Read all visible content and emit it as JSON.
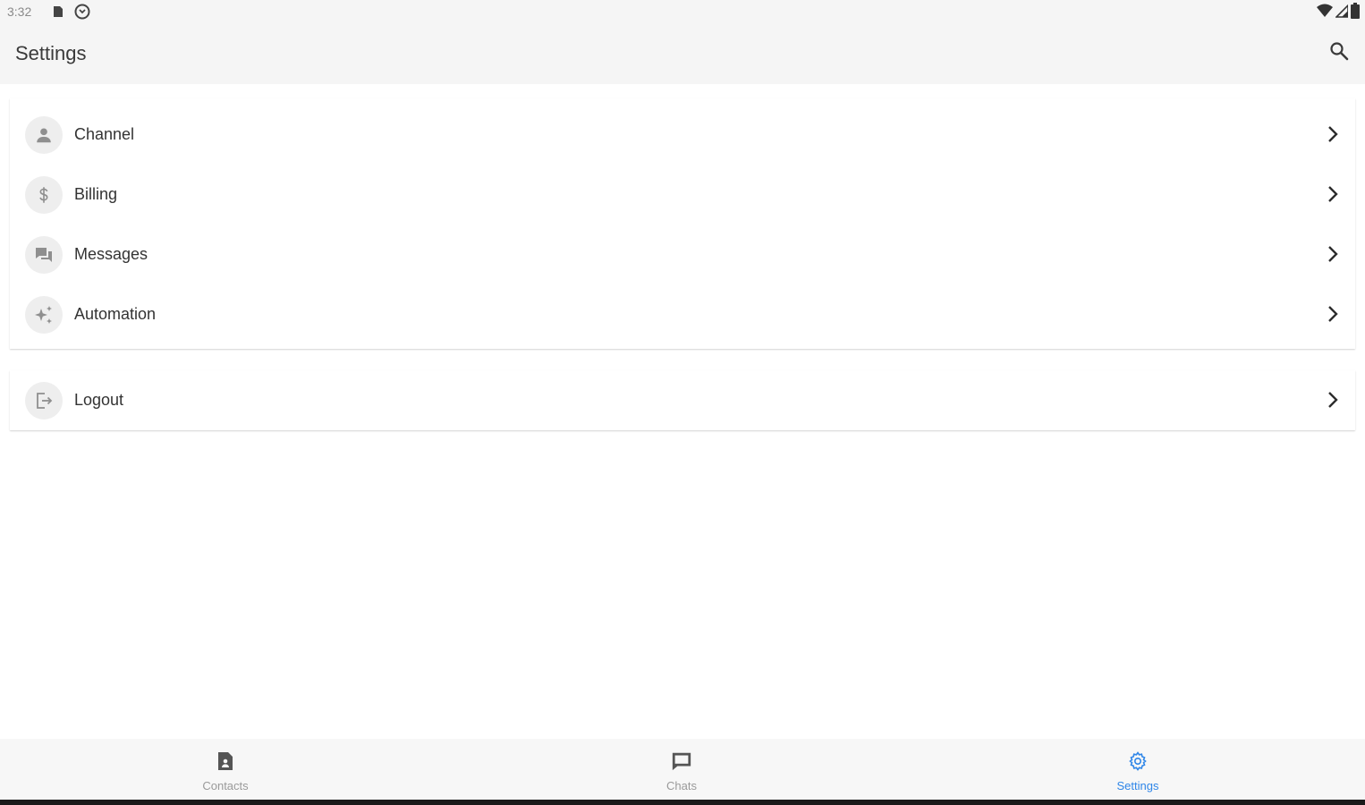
{
  "status_bar": {
    "time": "3:32",
    "left_icons": [
      "sd-card-icon",
      "sync-icon"
    ],
    "right_icons": [
      "wifi-icon",
      "signal-icon",
      "battery-icon"
    ]
  },
  "app_bar": {
    "title": "Settings",
    "search_icon": "search-icon"
  },
  "settings_items": [
    {
      "label": "Channel",
      "icon": "person-icon"
    },
    {
      "label": "Billing",
      "icon": "dollar-icon"
    },
    {
      "label": "Messages",
      "icon": "chat-bubbles-icon"
    },
    {
      "label": "Automation",
      "icon": "sparkle-icon"
    }
  ],
  "logout_item": {
    "label": "Logout",
    "icon": "logout-icon"
  },
  "bottom_nav": {
    "items": [
      {
        "label": "Contacts",
        "icon": "contact-card-icon",
        "active": false
      },
      {
        "label": "Chats",
        "icon": "chat-icon",
        "active": false
      },
      {
        "label": "Settings",
        "icon": "gear-icon",
        "active": true
      }
    ]
  },
  "colors": {
    "accent": "#2f86e8",
    "app_bar_bg": "#f5f5f5",
    "icon_gray": "#8f8f8f",
    "text": "#333333"
  }
}
